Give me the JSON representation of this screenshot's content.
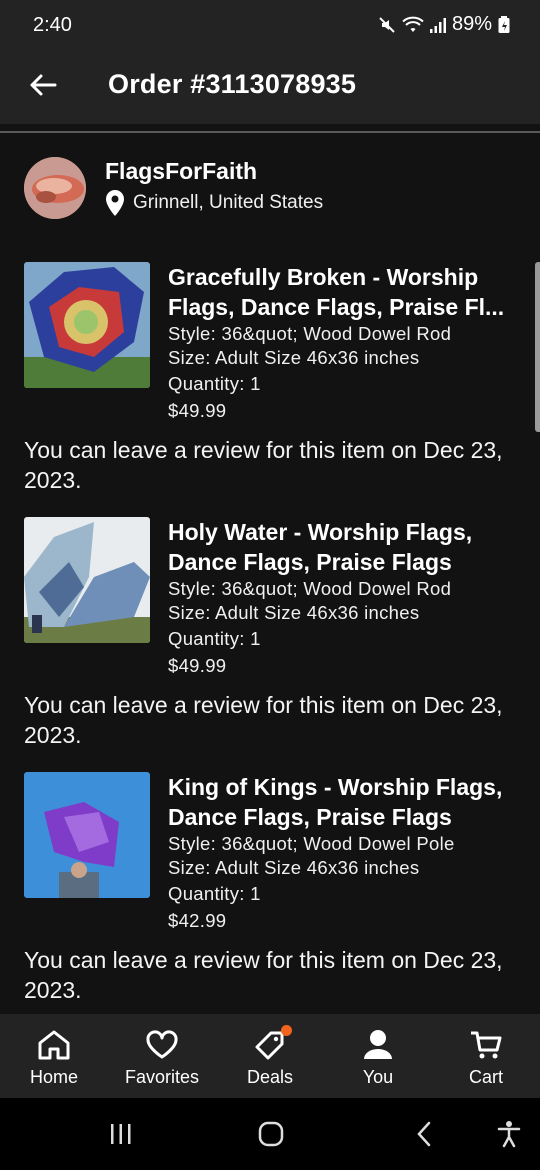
{
  "status": {
    "time": "2:40",
    "battery": "89%"
  },
  "header": {
    "title": "Order #3113078935"
  },
  "shop": {
    "name": "FlagsForFaith",
    "location": "Grinnell, United States"
  },
  "items": [
    {
      "title": "Gracefully Broken - Worship Flags, Dance Flags, Praise Fl...",
      "style": "Style: 36&quot; Wood Dowel Rod",
      "size": "Size: Adult Size 46x36 inches",
      "quantity": "Quantity: 1",
      "price": "$49.99",
      "review_note": "You can leave a review for this item on Dec 23, 2023."
    },
    {
      "title": "Holy Water - Worship Flags, Dance Flags, Praise Flags",
      "style": "Style: 36&quot; Wood Dowel Rod",
      "size": "Size: Adult Size 46x36 inches",
      "quantity": "Quantity: 1",
      "price": "$49.99",
      "review_note": "You can leave a review for this item on Dec 23, 2023."
    },
    {
      "title": "King of Kings - Worship Flags, Dance Flags, Praise Flags",
      "style": "Style: 36&quot; Wood Dowel Pole",
      "size": "Size: Adult Size 46x36 inches",
      "quantity": "Quantity: 1",
      "price": "$42.99",
      "review_note": "You can leave a review for this item on Dec 23, 2023."
    }
  ],
  "nav": {
    "home": "Home",
    "favorites": "Favorites",
    "deals": "Deals",
    "you": "You",
    "cart": "Cart"
  },
  "colors": {
    "background": "#121212",
    "bar": "#232323",
    "deals_badge": "#f1641e"
  }
}
